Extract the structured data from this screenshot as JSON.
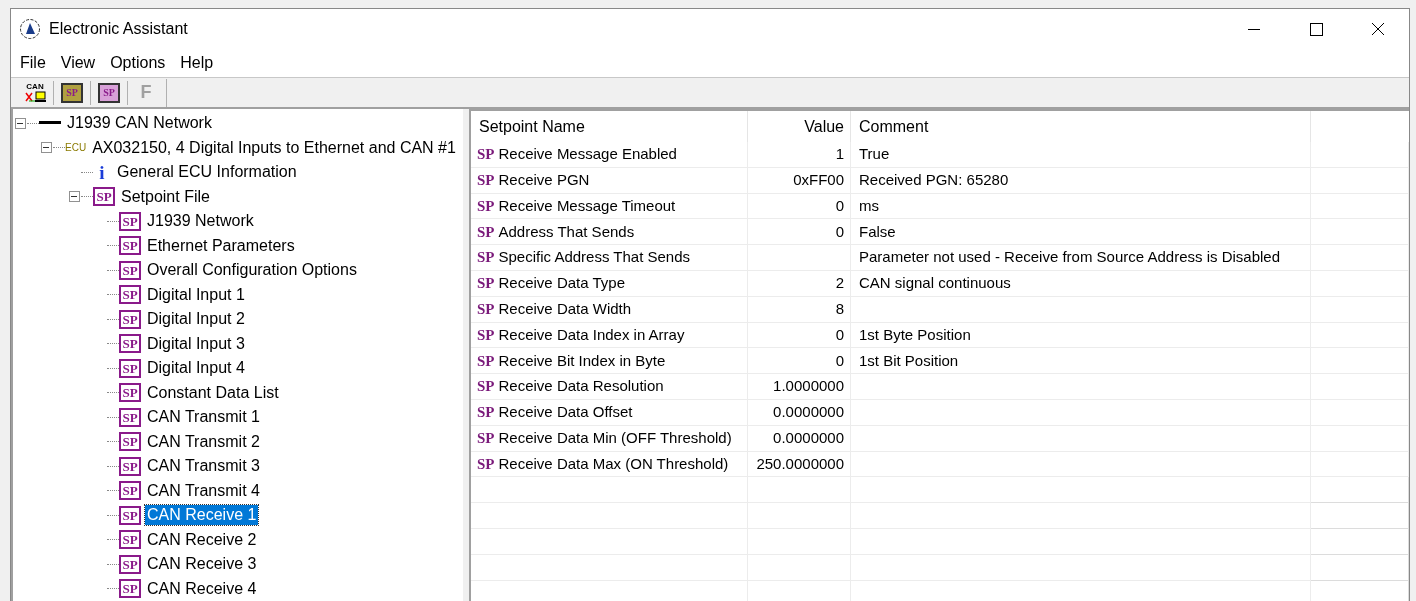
{
  "window": {
    "title": "Electronic Assistant"
  },
  "menu": [
    "File",
    "View",
    "Options",
    "Help"
  ],
  "toolbar": [
    {
      "kind": "can",
      "label": "CAN"
    },
    {
      "kind": "open",
      "label": "SP"
    },
    {
      "kind": "save",
      "label": "SP"
    },
    {
      "kind": "letter",
      "label": "F",
      "disabled": true
    }
  ],
  "tree": [
    {
      "label": "J1939 CAN Network",
      "kind": "network",
      "expanded": true,
      "selected": false,
      "children": [
        {
          "label": "AX032150, 4 Digital Inputs to Ethernet and CAN #1",
          "kind": "ecu",
          "badge": "ECU",
          "expanded": true,
          "selected": false,
          "children": [
            {
              "label": "General ECU Information",
              "kind": "info",
              "badge": "i",
              "selected": false
            },
            {
              "label": "Setpoint File",
              "kind": "file",
              "badge": "SP",
              "expanded": true,
              "selected": false,
              "children": [
                {
                  "label": "J1939 Network",
                  "kind": "sp",
                  "badge": "SP",
                  "selected": false
                },
                {
                  "label": "Ethernet Parameters",
                  "kind": "sp",
                  "badge": "SP",
                  "selected": false
                },
                {
                  "label": "Overall Configuration Options",
                  "kind": "sp",
                  "badge": "SP",
                  "selected": false
                },
                {
                  "label": "Digital Input 1",
                  "kind": "sp",
                  "badge": "SP",
                  "selected": false
                },
                {
                  "label": "Digital Input 2",
                  "kind": "sp",
                  "badge": "SP",
                  "selected": false
                },
                {
                  "label": "Digital Input 3",
                  "kind": "sp",
                  "badge": "SP",
                  "selected": false
                },
                {
                  "label": "Digital Input 4",
                  "kind": "sp",
                  "badge": "SP",
                  "selected": false
                },
                {
                  "label": "Constant Data List",
                  "kind": "sp",
                  "badge": "SP",
                  "selected": false
                },
                {
                  "label": "CAN Transmit 1",
                  "kind": "sp",
                  "badge": "SP",
                  "selected": false
                },
                {
                  "label": "CAN Transmit 2",
                  "kind": "sp",
                  "badge": "SP",
                  "selected": false
                },
                {
                  "label": "CAN Transmit 3",
                  "kind": "sp",
                  "badge": "SP",
                  "selected": false
                },
                {
                  "label": "CAN Transmit 4",
                  "kind": "sp",
                  "badge": "SP",
                  "selected": false
                },
                {
                  "label": "CAN Receive 1",
                  "kind": "sp",
                  "badge": "SP",
                  "selected": true
                },
                {
                  "label": "CAN Receive 2",
                  "kind": "sp",
                  "badge": "SP",
                  "selected": false
                },
                {
                  "label": "CAN Receive 3",
                  "kind": "sp",
                  "badge": "SP",
                  "selected": false
                },
                {
                  "label": "CAN Receive 4",
                  "kind": "sp",
                  "badge": "SP",
                  "selected": false
                }
              ]
            }
          ]
        }
      ]
    }
  ],
  "table": {
    "columns": [
      "Setpoint Name",
      "Value",
      "Comment"
    ],
    "rows": [
      {
        "badge": "SP",
        "name": "Receive Message Enabled",
        "value": "1",
        "comment": "True"
      },
      {
        "badge": "SP",
        "name": "Receive PGN",
        "value": "0xFF00",
        "comment": "Received PGN: 65280"
      },
      {
        "badge": "SP",
        "name": "Receive Message Timeout",
        "value": "0",
        "comment": "ms"
      },
      {
        "badge": "SP",
        "name": "Address That Sends",
        "value": "0",
        "comment": "False"
      },
      {
        "badge": "SP",
        "name": "Specific Address That Sends",
        "comment": "Parameter not used - Receive from Source Address is Disabled"
      },
      {
        "badge": "SP",
        "name": "Receive Data Type",
        "value": "2",
        "comment": "CAN signal continuous"
      },
      {
        "badge": "SP",
        "name": "Receive Data Width",
        "value": "8"
      },
      {
        "badge": "SP",
        "name": "Receive Data Index in Array",
        "value": "0",
        "comment": "1st Byte Position"
      },
      {
        "badge": "SP",
        "name": "Receive Bit Index in Byte",
        "value": "0",
        "comment": "1st Bit Position"
      },
      {
        "badge": "SP",
        "name": "Receive Data Resolution",
        "value": "1.0000000"
      },
      {
        "badge": "SP",
        "name": "Receive Data Offset",
        "value": "0.0000000"
      },
      {
        "badge": "SP",
        "name": "Receive Data Min (OFF Threshold)",
        "value": "0.0000000"
      },
      {
        "badge": "SP",
        "name": "Receive Data Max (ON Threshold)",
        "value": "250.0000000"
      }
    ]
  }
}
